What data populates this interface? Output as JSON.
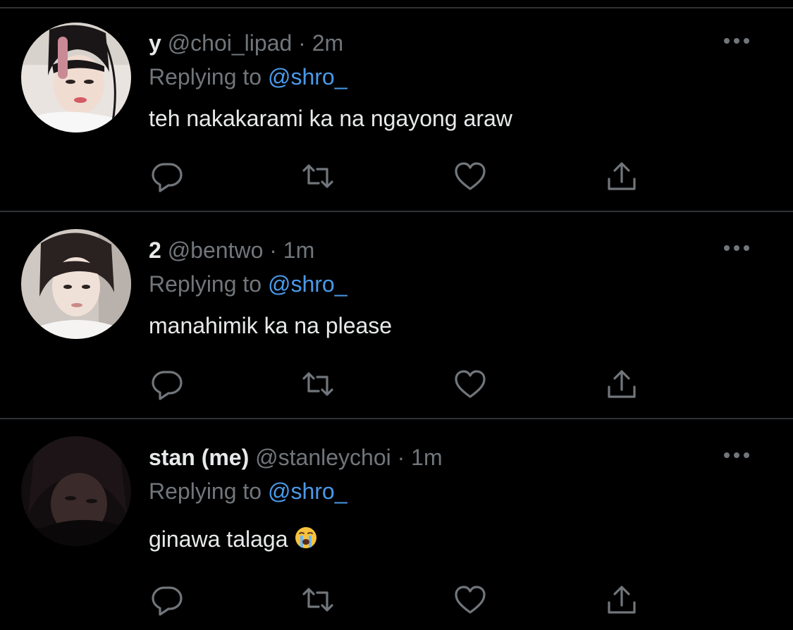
{
  "colors": {
    "background": "#000000",
    "divider": "#2f3336",
    "primary_text": "#e7e9ea",
    "secondary_text": "#71767b",
    "link": "#4a99e9",
    "icon": "#71767b"
  },
  "tweets": [
    {
      "display_name": "y",
      "handle": "@choi_lipad",
      "separator": "·",
      "time": "2m",
      "reply_prefix": "Replying to",
      "reply_to": "@shro_",
      "text": "teh nakakarami ka na ngayong araw",
      "emoji": ""
    },
    {
      "display_name": "2",
      "handle": "@bentwo",
      "separator": "·",
      "time": "1m",
      "reply_prefix": "Replying to",
      "reply_to": "@shro_",
      "text": "manahimik ka na please",
      "emoji": ""
    },
    {
      "display_name": "stan (me)",
      "handle": "@stanleychoi",
      "separator": "·",
      "time": "1m",
      "reply_prefix": "Replying to",
      "reply_to": "@shro_",
      "text": "ginawa talaga",
      "emoji": "loudly-crying-face"
    }
  ],
  "icons": {
    "reply": "reply-icon",
    "retweet": "retweet-icon",
    "like": "heart-icon",
    "share": "share-icon",
    "more": "more-options-icon"
  }
}
